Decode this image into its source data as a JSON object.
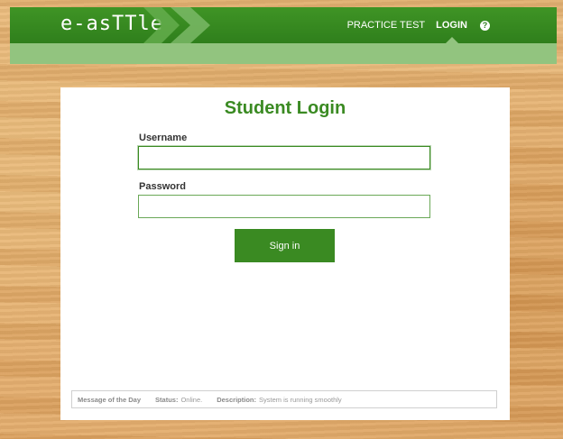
{
  "header": {
    "logo_text": "e-asTTle",
    "nav": [
      {
        "label": "PRACTICE TEST"
      },
      {
        "label": "LOGIN"
      }
    ],
    "help_glyph": "?",
    "icons": {
      "help": "help-icon",
      "chevrons": "chevron-right-icon"
    },
    "colors": {
      "bar": "#3f9425",
      "subbar": "#92c47f",
      "accent": "#3a8a22"
    }
  },
  "login": {
    "title": "Student Login",
    "username_label": "Username",
    "username_value": "",
    "password_label": "Password",
    "password_value": "",
    "submit_label": "Sign in"
  },
  "footer": {
    "motd_label": "Message of the Day",
    "status_label": "Status:",
    "status_value": "Online.",
    "description_label": "Description:",
    "description_value": "System is running smoothly"
  }
}
